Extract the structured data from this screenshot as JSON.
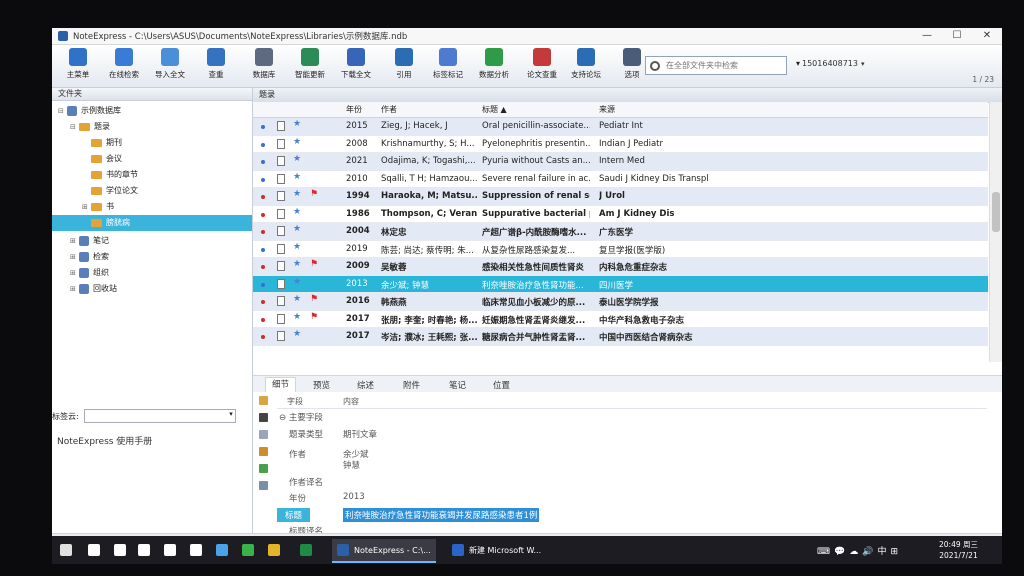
{
  "window": {
    "title": "NoteExpress - C:\\Users\\ASUS\\Documents\\NoteExpress\\Libraries\\示例数据库.ndb",
    "controls": [
      "—",
      "☐",
      "✕"
    ]
  },
  "toolbar": {
    "buttons": [
      {
        "label": "主菜单",
        "color": "#2f73c9"
      },
      {
        "label": "在线检索",
        "color": "#3a7bd5"
      },
      {
        "label": "导入全文",
        "color": "#4b8fd8"
      },
      {
        "label": "查重",
        "color": "#3572c0"
      },
      {
        "label": "数据库",
        "color": "#5c6b7f"
      },
      {
        "label": "智能更新",
        "color": "#2d8b57"
      },
      {
        "label": "下载全文",
        "color": "#3766b8"
      },
      {
        "label": "引用",
        "color": "#2a6db5"
      },
      {
        "label": "标签标记",
        "color": "#4c7bd0"
      },
      {
        "label": "数据分析",
        "color": "#2f9a48"
      },
      {
        "label": "论文查重",
        "color": "#c23a3a"
      },
      {
        "label": "支持论坛",
        "color": "#2a6db5"
      },
      {
        "label": "选项",
        "color": "#4a5d78"
      }
    ],
    "search_placeholder": "在全部文件夹中检索",
    "account": "15016408713",
    "pager": "1 / 23"
  },
  "sidebar": {
    "header": "文件夹",
    "tree": [
      {
        "label": "示例数据库",
        "level": 0,
        "exp": "⊟",
        "kind": "db",
        "sel": false
      },
      {
        "label": "题录",
        "level": 1,
        "exp": "⊟",
        "kind": "folder",
        "sel": false
      },
      {
        "label": "期刊",
        "level": 2,
        "exp": "",
        "kind": "folder",
        "sel": false
      },
      {
        "label": "会议",
        "level": 2,
        "exp": "",
        "kind": "folder",
        "sel": false
      },
      {
        "label": "书的章节",
        "level": 2,
        "exp": "",
        "kind": "folder",
        "sel": false
      },
      {
        "label": "学位论文",
        "level": 2,
        "exp": "",
        "kind": "folder",
        "sel": false
      },
      {
        "label": "书",
        "level": 2,
        "exp": "⊞",
        "kind": "folder",
        "sel": false
      },
      {
        "label": "膀胱病",
        "level": 2,
        "exp": "",
        "kind": "folder",
        "sel": true
      },
      {
        "label": "笔记",
        "level": 1,
        "exp": "⊞",
        "kind": "db",
        "sel": false
      },
      {
        "label": "检索",
        "level": 1,
        "exp": "⊞",
        "kind": "db",
        "sel": false
      },
      {
        "label": "组织",
        "level": 1,
        "exp": "⊞",
        "kind": "db",
        "sel": false
      },
      {
        "label": "回收站",
        "level": 1,
        "exp": "⊞",
        "kind": "db",
        "sel": false
      }
    ],
    "tag_cloud_label": "标签云:",
    "manual": "NoteExpress  使用手册"
  },
  "records": {
    "header": "题录",
    "columns": {
      "year": "年份",
      "author": "作者",
      "title": "标题  ▲",
      "source": "来源"
    },
    "rows": [
      {
        "dot": "#3a6fd0",
        "flag": false,
        "bold": false,
        "year": "2015",
        "author": "Zieg, J; Hacek, J",
        "title": "Oral penicillin-associate...",
        "source": "Pediatr Int"
      },
      {
        "dot": "#3a6fd0",
        "flag": false,
        "bold": false,
        "year": "2008",
        "author": "Krishnamurthy, S; H...",
        "title": "Pyelonephritis presentin...",
        "source": "Indian J Pediatr"
      },
      {
        "dot": "#3a6fd0",
        "flag": false,
        "bold": false,
        "year": "2021",
        "author": "Odajima, K; Togashi,...",
        "title": "Pyuria without Casts an...",
        "source": "Intern Med"
      },
      {
        "dot": "#3a6fd0",
        "flag": false,
        "bold": false,
        "year": "2010",
        "author": "Sqalli, T H; Hamzaou...",
        "title": "Severe renal failure in ac...",
        "source": "Saudi J Kidney Dis Transpl"
      },
      {
        "dot": "#d42a2a",
        "flag": true,
        "bold": true,
        "year": "1994",
        "author": "Haraoka, M; Matsu...",
        "title": "Suppression of renal sca",
        "source": "J Urol"
      },
      {
        "dot": "#d42a2a",
        "flag": false,
        "bold": true,
        "year": "1986",
        "author": "Thompson, C; Veran",
        "title": "Suppurative bacterial py",
        "source": "Am J Kidney Dis"
      },
      {
        "dot": "#d42a2a",
        "flag": false,
        "bold": true,
        "year": "2004",
        "author": "林定忠",
        "title": "产超广谱β-内酰胺酶嗜水...",
        "source": "广东医学"
      },
      {
        "dot": "#3a6fd0",
        "flag": false,
        "bold": false,
        "year": "2019",
        "author": "陈芸; 尚达; 蔡传明; 朱...",
        "title": "从复杂性尿路感染复发...",
        "source": "复旦学报(医学版)"
      },
      {
        "dot": "#d42a2a",
        "flag": true,
        "bold": true,
        "year": "2009",
        "author": "吴敏蓉",
        "title": "感染相关性急性间质性肾炎",
        "source": "内科急危重症杂志"
      },
      {
        "dot": "#3a6fd0",
        "flag": false,
        "bold": false,
        "sel": true,
        "year": "2013",
        "author": "余少斌; 钟慧",
        "title": "利奈唑胺治疗急性肾功能...",
        "source": "四川医学"
      },
      {
        "dot": "#d42a2a",
        "flag": true,
        "bold": true,
        "year": "2016",
        "author": "韩燕燕",
        "title": "临床常见血小板减少的原...",
        "source": "泰山医学院学报"
      },
      {
        "dot": "#d42a2a",
        "flag": true,
        "bold": true,
        "year": "2017",
        "author": "张朋; 李奎; 时春艳; 杨...",
        "title": "妊娠期急性肾盂肾炎继发...",
        "source": "中华产科急救电子杂志"
      },
      {
        "dot": "#d42a2a",
        "flag": false,
        "bold": true,
        "year": "2017",
        "author": "岑洁; 濮冰; 王耗熙; 张...",
        "title": "糖尿病合并气肿性肾盂肾...",
        "source": "中国中西医结合肾病杂志"
      }
    ]
  },
  "tabs": [
    "细节",
    "预览",
    "综述",
    "附件",
    "笔记",
    "位置"
  ],
  "details": {
    "col_field": "字段",
    "col_content": "内容",
    "section": "⊖  主要字段",
    "rows": [
      {
        "k": "题录类型",
        "v": "期刊文章"
      },
      {
        "k": "作者",
        "v": "余少斌"
      },
      {
        "k": "",
        "v": "钟慧"
      },
      {
        "k": "作者译名",
        "v": ""
      },
      {
        "k": "年份",
        "v": "2013"
      },
      {
        "k": "标题",
        "v": "利奈唑胺治疗急性肾功能衰竭并发尿路感染患者1例",
        "hl": true
      },
      {
        "k": "标题译名",
        "v": ""
      }
    ]
  },
  "taskbar": {
    "items": [
      {
        "label": "",
        "color": "#e0e0e0"
      },
      {
        "label": "",
        "color": "#ffffff"
      },
      {
        "label": "",
        "color": "#ffffff"
      },
      {
        "label": "",
        "color": "#ffffff"
      },
      {
        "label": "",
        "color": "#ffffff"
      },
      {
        "label": "",
        "color": "#ffffff"
      },
      {
        "label": "",
        "color": "#4aa3e8"
      },
      {
        "label": "",
        "color": "#38b44a"
      },
      {
        "label": "",
        "color": "#e4b42a"
      },
      {
        "label": "",
        "color": "#1f8a45"
      },
      {
        "label": "NoteExpress - C:\\...",
        "color": "#2b5fa8",
        "active": true
      },
      {
        "label": "新建 Microsoft W...",
        "color": "#2b63c6"
      }
    ],
    "tray": [
      "⌨",
      "💬",
      "☁",
      "🔊",
      "中",
      "⊞"
    ],
    "time": "20:49 周三",
    "date": "2021/7/21"
  }
}
